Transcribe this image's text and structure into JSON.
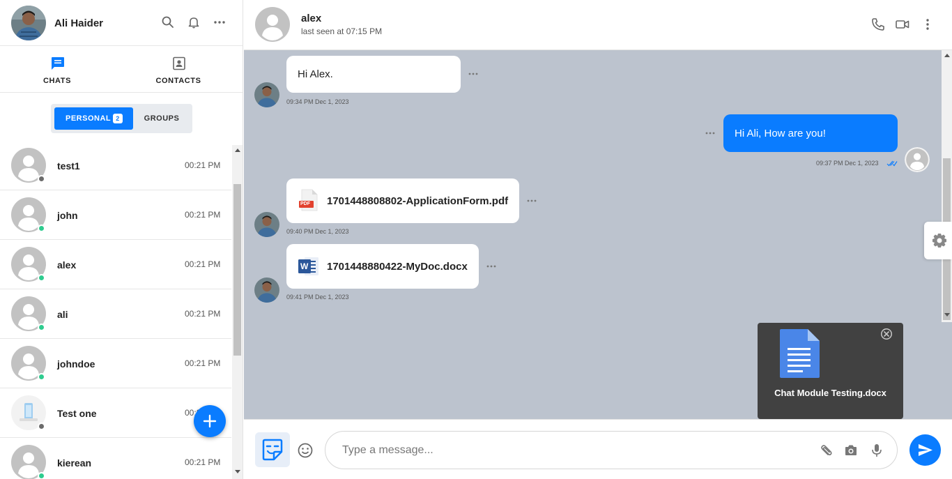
{
  "user": {
    "name": "Ali Haider"
  },
  "sidebar": {
    "tabs": [
      {
        "label": "CHATS"
      },
      {
        "label": "CONTACTS"
      }
    ],
    "segment": {
      "personal_label": "PERSONAL",
      "personal_count": "2",
      "groups_label": "GROUPS"
    },
    "contacts": [
      {
        "name": "test1",
        "time": "00:21 PM",
        "status": "offline"
      },
      {
        "name": "john",
        "time": "00:21 PM",
        "status": "online"
      },
      {
        "name": "alex",
        "time": "00:21 PM",
        "status": "online"
      },
      {
        "name": "ali",
        "time": "00:21 PM",
        "status": "online"
      },
      {
        "name": "johndoe",
        "time": "00:21 PM",
        "status": "online"
      },
      {
        "name": "Test one",
        "time": "00:21 PM",
        "status": "offline"
      },
      {
        "name": "kierean",
        "time": "00:21 PM",
        "status": "online"
      }
    ]
  },
  "chat": {
    "name": "alex",
    "status": "last seen at 07:15 PM",
    "messages": [
      {
        "direction": "in",
        "type": "text",
        "text": "Hi Alex.",
        "time": "09:34 PM Dec 1, 2023"
      },
      {
        "direction": "out",
        "type": "text",
        "text": "Hi Ali, How are you!",
        "time": "09:37 PM Dec 1, 2023"
      },
      {
        "direction": "in",
        "type": "file",
        "file_icon": "pdf-icon",
        "file_badge": "PDF",
        "text": "1701448808802-ApplicationForm.pdf",
        "time": "09:40 PM Dec 1, 2023"
      },
      {
        "direction": "in",
        "type": "file",
        "file_icon": "word-icon",
        "file_badge": "W",
        "text": "1701448880422-MyDoc.docx",
        "time": "09:41 PM Dec 1, 2023"
      }
    ],
    "preview": {
      "file_name": "Chat Module Testing.docx"
    }
  },
  "composer": {
    "placeholder": "Type a message..."
  },
  "colors": {
    "accent": "#0a7cff",
    "chat_background": "#bcc3ce",
    "online": "#2ecc8f",
    "offline": "#6b6b6b"
  }
}
